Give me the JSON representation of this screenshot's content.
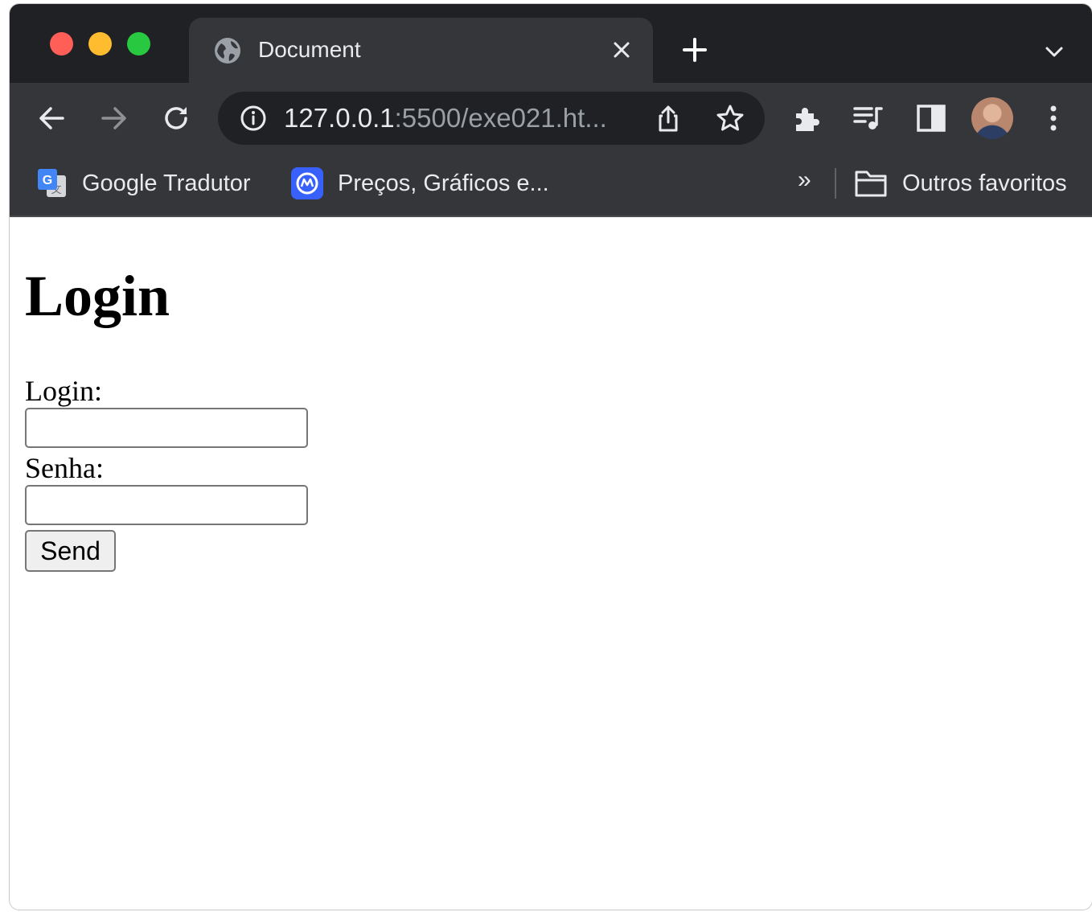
{
  "browser": {
    "tab": {
      "title": "Document",
      "favicon": "globe-icon",
      "close_icon": "close-icon"
    },
    "new_tab_icon": "plus-icon",
    "tab_search_icon": "chevron-down-icon",
    "toolbar": {
      "back_icon": "arrow-left-icon",
      "forward_icon": "arrow-right-icon",
      "reload_icon": "reload-icon",
      "site_info_icon": "info-icon",
      "url_host": "127.0.0.1",
      "url_rest": ":5500/exe021.ht...",
      "share_icon": "share-icon",
      "bookmark_icon": "star-icon",
      "extensions_icon": "puzzle-icon",
      "media_icon": "playlist-icon",
      "side_panel_icon": "side-panel-icon",
      "menu_icon": "kebab-menu-icon"
    },
    "bookmarks": {
      "items": [
        {
          "label": "Google Tradutor",
          "icon": "google-translate-icon"
        },
        {
          "label": "Preços, Gráficos e...",
          "icon": "coinmarket-icon"
        }
      ],
      "overflow": "»",
      "other": {
        "label": "Outros favoritos",
        "icon": "folder-icon"
      }
    },
    "colors": {
      "frame": "#202124",
      "toolbar": "#35363a",
      "text": "#e8eaed",
      "url_dim": "#9aa0a6"
    }
  },
  "page": {
    "title": "Login",
    "form": {
      "login_label": "Login:",
      "login_value": "",
      "password_label": "Senha:",
      "password_value": "",
      "submit_label": "Send"
    }
  }
}
